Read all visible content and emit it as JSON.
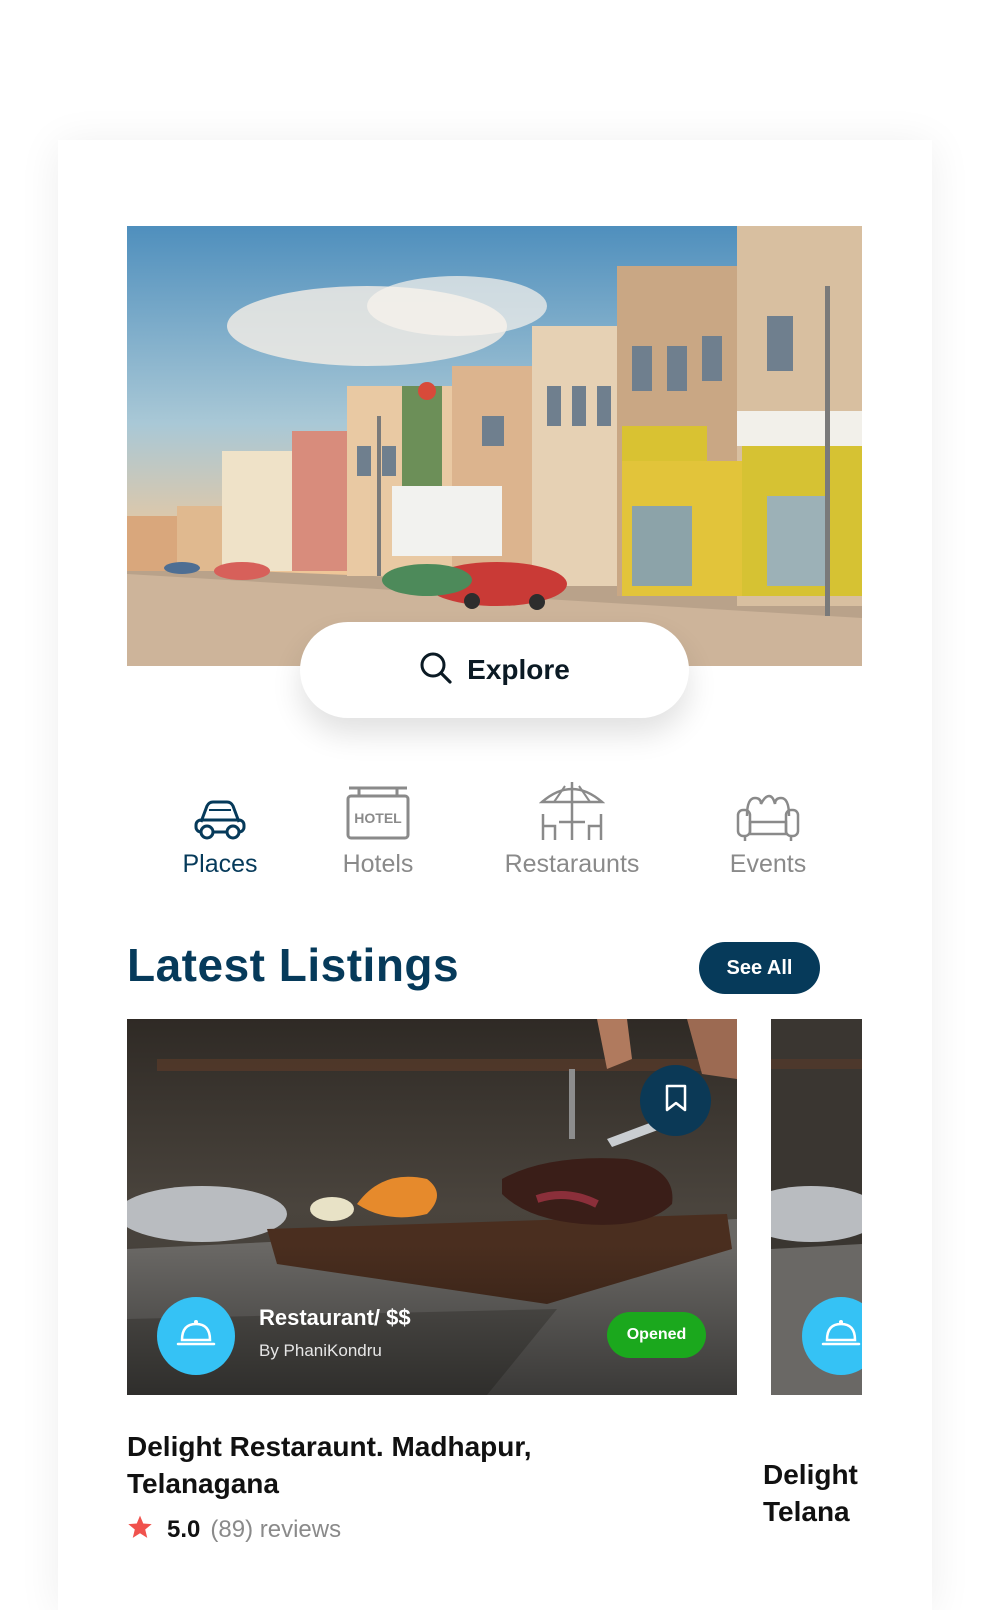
{
  "hero": {
    "explore_label": "Explore"
  },
  "categories": [
    {
      "label": "Places",
      "icon": "car-icon",
      "active": true
    },
    {
      "label": "Hotels",
      "icon": "hotel-sign-icon",
      "active": false
    },
    {
      "label": "Restaraunts",
      "icon": "outdoor-table-umbrella-icon",
      "active": false
    },
    {
      "label": "Events",
      "icon": "sofa-icon",
      "active": false
    }
  ],
  "latest": {
    "title": "Latest Listings",
    "see_all_label": "See All"
  },
  "listings": [
    {
      "category": "Restaurant/ $$",
      "by": "By PhaniKondru",
      "status": "Opened",
      "title": "Delight Restaraunt.  Madhapur, Telanagana",
      "rating": "5.0",
      "reviews": "(89) reviews"
    },
    {
      "title_line1": "Delight",
      "title_line2": "Telana"
    }
  ],
  "colors": {
    "primary": "#063a5a",
    "accent_blue": "#35c2f5",
    "status_green": "#1ba81d",
    "star": "#f0524d",
    "muted": "#8a8a8a"
  }
}
